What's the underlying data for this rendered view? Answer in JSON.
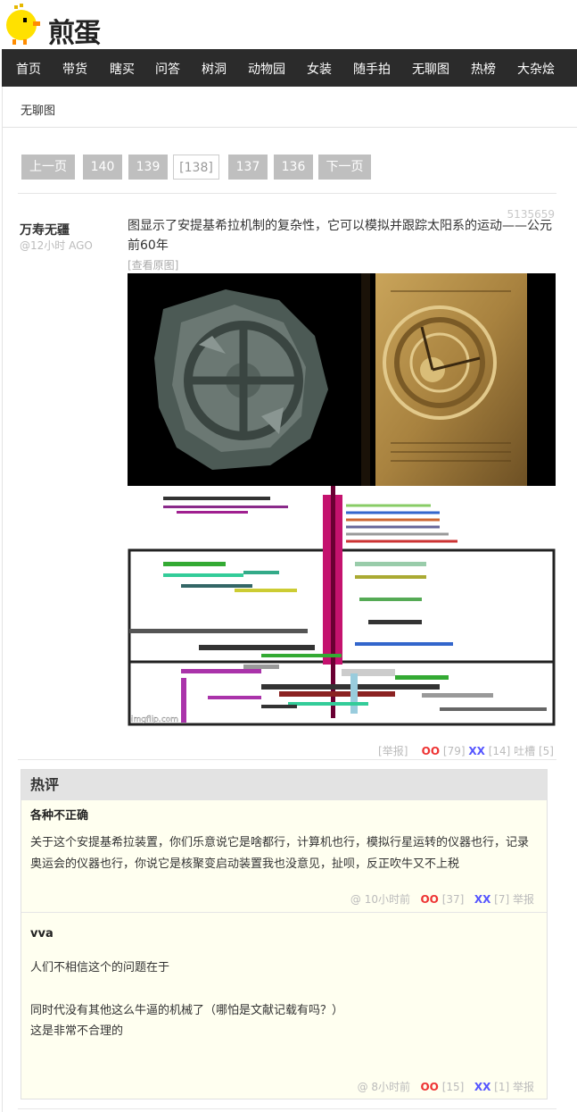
{
  "brand": {
    "logo_text": "煎蛋"
  },
  "nav": {
    "items": [
      "首页",
      "带货",
      "瞎买",
      "问答",
      "树洞",
      "动物园",
      "女装",
      "随手拍",
      "无聊图",
      "热榜",
      "大杂烩"
    ]
  },
  "breadcrumb": "无聊图",
  "pager": {
    "prev": "上一页",
    "pages": [
      "140",
      "139",
      "[138]",
      "137",
      "136"
    ],
    "next": "下一页"
  },
  "post": {
    "id": "5135659",
    "author": "万寿无疆",
    "time": "@12小时 AGO",
    "text": "图显示了安提基希拉机制的复杂性，它可以模拟并跟踪太阳系的运动——公元前60年",
    "view_original": "[查看原图]",
    "watermark": "imgflip.com",
    "report": "[举报]",
    "oo_label": "OO",
    "oo_count": "[79]",
    "xx_label": "XX",
    "xx_count": "[14]",
    "tucao": "吐槽 [5]"
  },
  "hot_comments": {
    "title": "热评",
    "items": [
      {
        "author": "各种不正确",
        "lines": [
          "关于这个安提基希拉装置，你们乐意说它是啥都行，计算机也行，模拟行星运转的仪器也行，记录奥运会的仪器也行，你说它是核聚变启动装置我也没意见，扯呗，反正吹牛又不上税"
        ],
        "at": "@",
        "time": "10小时前",
        "oo_label": "OO",
        "oo_count": "[37]",
        "xx_label": "XX",
        "xx_count": "[7]",
        "report": "举报"
      },
      {
        "author": "vva",
        "lines": [
          "人们不相信这个的问题在于",
          "同时代没有其他这么牛逼的机械了（哪怕是文献记载有吗？）",
          "这是非常不合理的"
        ],
        "at": "@",
        "time": "8小时前",
        "oo_label": "OO",
        "oo_count": "[15]",
        "xx_label": "XX",
        "xx_count": "[1]",
        "report": "举报"
      }
    ]
  },
  "colors": {
    "nav_bg": "#2b2b2b",
    "pager_bg": "#bfbfbf",
    "oo": "#e33333",
    "xx": "#5555ff",
    "hot_bg": "#fffff0"
  }
}
